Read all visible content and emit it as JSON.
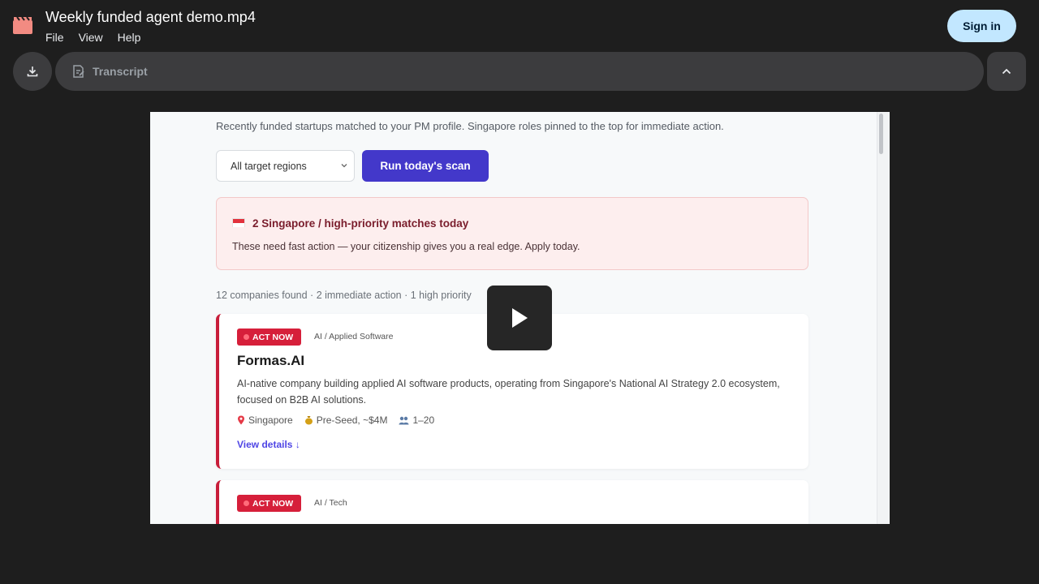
{
  "header": {
    "title": "Weekly funded agent demo.mp4",
    "menu": [
      "File",
      "View",
      "Help"
    ],
    "signin_label": "Sign in"
  },
  "toolbar": {
    "transcript_label": "Transcript"
  },
  "video": {
    "subtitle": "Recently funded startups matched to your PM profile. Singapore roles pinned to the top for immediate action.",
    "region_select": "All target regions",
    "run_button": "Run today's scan",
    "alert": {
      "heading": "2 Singapore / high-priority matches today",
      "body": "These need fast action — your citizenship gives you a real edge. Apply today."
    },
    "summary": "12 companies found · 2 immediate action · 1 high priority",
    "cards": [
      {
        "badge": "ACT NOW",
        "category": "AI / Applied Software",
        "name": "Formas.AI",
        "description": "AI-native company building applied AI software products, operating from Singapore's National AI Strategy 2.0 ecosystem, focused on B2B AI solutions.",
        "location": "Singapore",
        "funding": "Pre-Seed, ~$4M",
        "team": "1–20",
        "details_link": "View details ↓"
      },
      {
        "badge": "ACT NOW",
        "category": "AI / Tech"
      }
    ]
  },
  "colors": {
    "background": "#1e1e1e",
    "signin_bg": "#c2e7ff",
    "run_button": "#4338ca",
    "act_now_badge": "#d61f3a"
  }
}
